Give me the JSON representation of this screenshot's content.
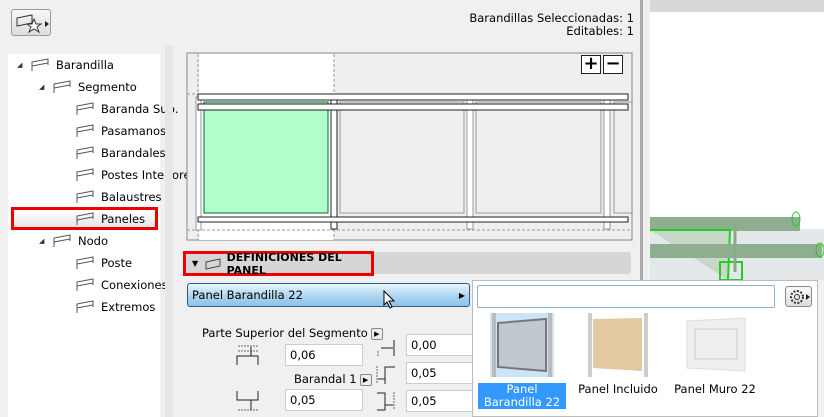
{
  "header": {
    "favorites_button": "favorites"
  },
  "status": {
    "selected": "Barandillas Seleccionadas: 1",
    "editable": "Editables: 1"
  },
  "tree": {
    "items": [
      {
        "label": "Barandilla",
        "icon": "railing-icon"
      },
      {
        "label": "Segmento",
        "icon": "segment-icon"
      },
      {
        "label": "Baranda Sup.",
        "icon": "top-rail-icon"
      },
      {
        "label": "Pasamanos",
        "icon": "handrail-icon"
      },
      {
        "label": "Barandales",
        "icon": "rails-icon"
      },
      {
        "label": "Postes Interiores",
        "icon": "inner-posts-icon"
      },
      {
        "label": "Balaustres",
        "icon": "balusters-icon"
      },
      {
        "label": "Paneles",
        "icon": "panel-icon",
        "selected": true
      },
      {
        "label": "Nodo",
        "icon": "node-icon"
      },
      {
        "label": "Poste",
        "icon": "post-icon"
      },
      {
        "label": "Conexiones",
        "icon": "connections-icon"
      },
      {
        "label": "Extremos",
        "icon": "ends-icon"
      }
    ]
  },
  "preview": {
    "zoom_in": "+",
    "zoom_out": "−",
    "highlight_color": "#b3ffcc"
  },
  "section": {
    "title": "DEFINICIONES DEL PANEL"
  },
  "panel_select": {
    "value": "Panel Barandilla 22"
  },
  "offsets": {
    "top_label": "Parte Superior del Segmento",
    "top_value": "0,06",
    "bottom_label": "Barandal 1",
    "bottom_value": "0,05",
    "right_values": [
      "0,00",
      "0,05",
      "0,05"
    ]
  },
  "library": {
    "search_placeholder": "",
    "items": [
      {
        "label": "Panel Barandilla 22",
        "selected": true
      },
      {
        "label": "Panel Incluido",
        "selected": false
      },
      {
        "label": "Panel Muro 22",
        "selected": false
      }
    ]
  }
}
